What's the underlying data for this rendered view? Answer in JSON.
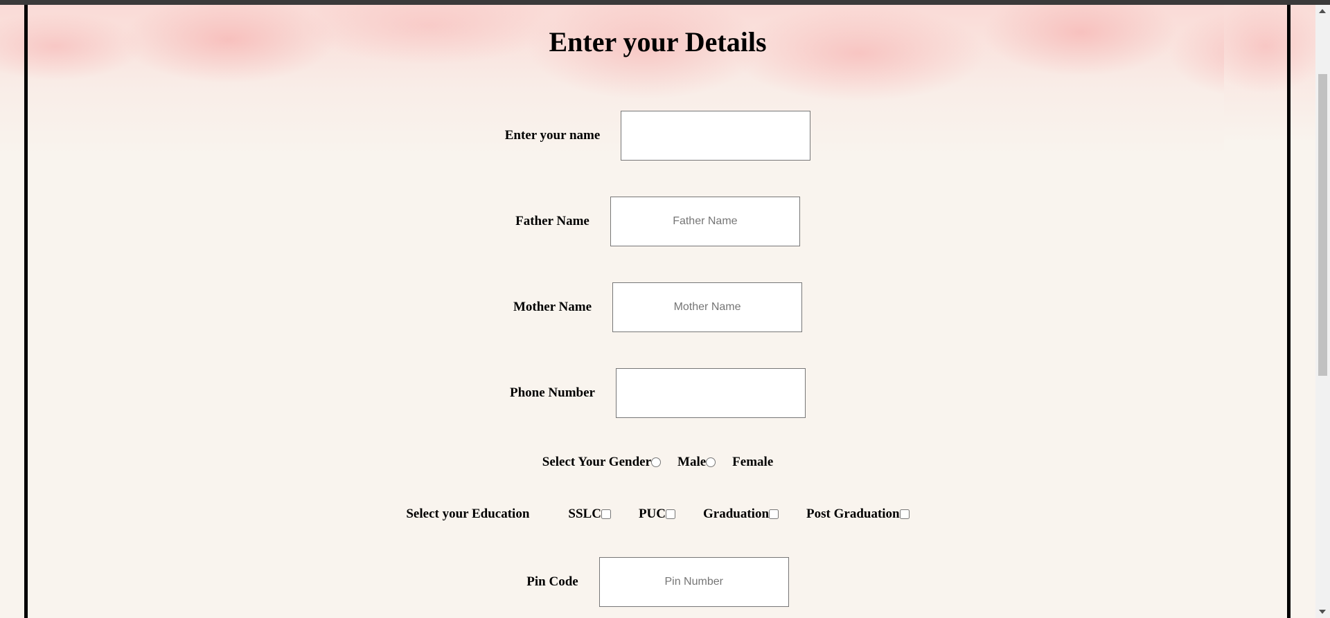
{
  "title": "Enter your Details",
  "fields": {
    "name": {
      "label": "Enter your name",
      "value": "",
      "placeholder": ""
    },
    "father": {
      "label": "Father Name",
      "value": "",
      "placeholder": "Father Name"
    },
    "mother": {
      "label": "Mother Name",
      "value": "",
      "placeholder": "Mother Name"
    },
    "phone": {
      "label": "Phone Number",
      "value": "",
      "placeholder": ""
    },
    "pin": {
      "label": "Pin Code",
      "value": "",
      "placeholder": "Pin Number"
    }
  },
  "gender": {
    "label": "Select Your Gender",
    "options": [
      "Male",
      "Female"
    ],
    "selected": null
  },
  "education": {
    "label": "Select your Education",
    "options": [
      "SSLC",
      "PUC",
      "Graduation",
      "Post Graduation"
    ],
    "checked": [
      false,
      false,
      false,
      false
    ]
  },
  "colors": {
    "background": "#f9f4ee",
    "splash": "#f6b6b4",
    "border": "#000000"
  }
}
